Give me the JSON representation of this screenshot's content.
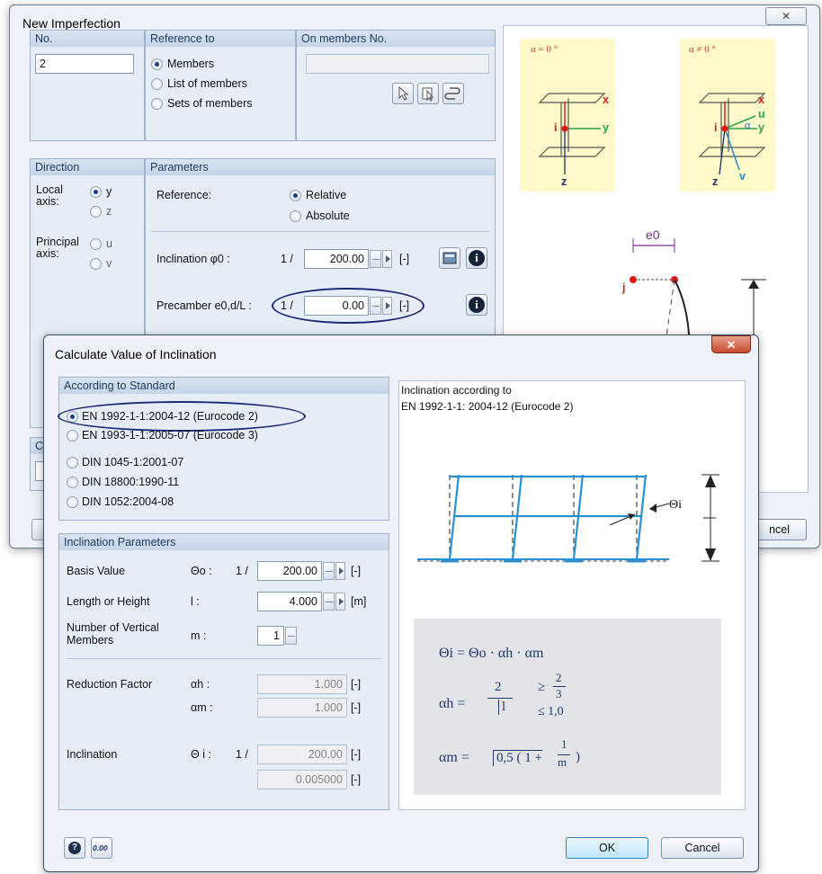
{
  "back_dialog": {
    "title": "New Imperfection",
    "no_group": {
      "label": "No.",
      "value": "2"
    },
    "reference_group": {
      "label": "Reference to",
      "options": [
        "Members",
        "List of members",
        "Sets of members"
      ],
      "selected": 0
    },
    "on_members_group": {
      "label": "On members No.",
      "value": ""
    },
    "direction_group": {
      "label": "Direction",
      "local_axis_label": "Local\naxis:",
      "local_options": [
        "y",
        "z"
      ],
      "principal_axis_label": "Principal\naxis:",
      "principal_options": [
        "u",
        "v"
      ]
    },
    "parameters_group": {
      "label": "Parameters",
      "reference_label": "Reference:",
      "reference_options": [
        "Relative",
        "Absolute"
      ],
      "inclination_label": "Inclination φ0 :",
      "inclination_prefix": "1 /",
      "inclination_value": "200.00",
      "inclination_unit": "[-]",
      "precamber_label": "Precamber e0,d/L :",
      "precamber_prefix": "1 /",
      "precamber_value": "0.00",
      "precamber_unit": "[-]"
    },
    "figure": {
      "alpha_zero": "α = 0 °",
      "alpha_nonzero": "α ≠ 0 °",
      "axes_left": [
        "x",
        "y",
        "z",
        "i"
      ],
      "axes_right": [
        "x",
        "u",
        "α",
        "y",
        "z",
        "v",
        "i"
      ],
      "e0_label": "e0",
      "j_label": "j"
    },
    "comment_partial": "Co",
    "cancel_partial": "ncel"
  },
  "front_dialog": {
    "title": "Calculate Value of Inclination",
    "close_symbol": "✕",
    "standard_group": {
      "label": "According to Standard",
      "options": [
        "EN 1992-1-1:2004-12 (Eurocode 2)",
        "EN 1993-1-1:2005-07 (Eurocode 3)",
        "DIN 1045-1:2001-07",
        "DIN 18800:1990-11",
        "DIN 1052:2004-08"
      ],
      "selected": 0
    },
    "params_group": {
      "label": "Inclination Parameters",
      "basis_label": "Basis Value",
      "basis_symbol": "Θo :",
      "basis_prefix": "1 /",
      "basis_value": "200.00",
      "basis_unit": "[-]",
      "length_label": "Length or Height",
      "length_symbol": "l :",
      "length_value": "4.000",
      "length_unit": "[m]",
      "vert_label": "Number of Vertical\nMembers",
      "vert_symbol": "m :",
      "vert_value": "1",
      "reduction_label": "Reduction Factor",
      "alpha_h_symbol": "αh :",
      "alpha_h_value": "1.000",
      "alpha_h_unit": "[-]",
      "alpha_m_symbol": "αm :",
      "alpha_m_value": "1.000",
      "alpha_m_unit": "[-]",
      "inclination_label": "Inclination",
      "theta_i_symbol": "Θ i :",
      "theta_i_prefix": "1 /",
      "theta_i_value": "200.00",
      "theta_i_unit": "[-]",
      "theta_i_decimal": "0.005000",
      "theta_i_decimal_unit": "[-]"
    },
    "info_panel": {
      "line1": "Inclination according to",
      "line2": "EN 1992-1-1: 2004-12  (Eurocode 2)",
      "theta_label": "Θi",
      "formula1": "Θi = Θo · αh · αm",
      "alpha_h_lhs": "αh =",
      "alpha_h_num": "2",
      "alpha_h_den": "l",
      "alpha_h_ge": "≥",
      "alpha_h_ge_frac_num": "2",
      "alpha_h_ge_frac_den": "3",
      "alpha_h_le": "≤ 1,0",
      "alpha_m_lhs": "αm =",
      "alpha_m_expr": "0,5 ( 1 +",
      "alpha_m_frac_num": "1",
      "alpha_m_frac_den": "m",
      "alpha_m_close": ")"
    },
    "ok_label": "OK",
    "cancel_label": "Cancel",
    "zero_icon_text": "0.00"
  }
}
